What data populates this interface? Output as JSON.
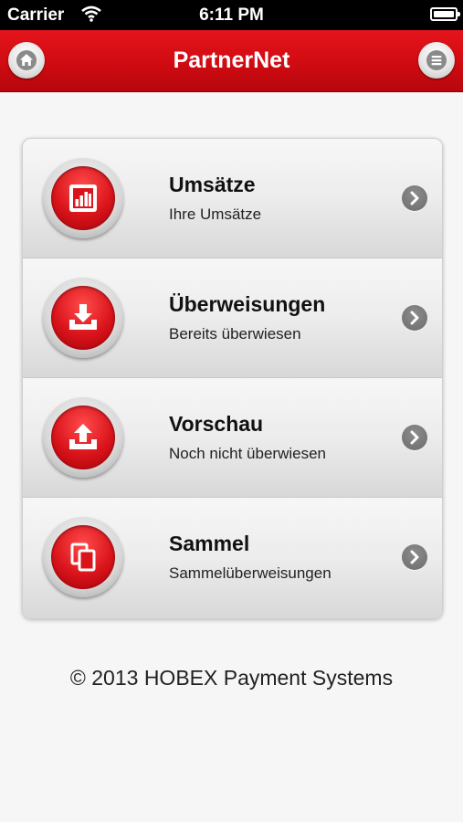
{
  "status_bar": {
    "carrier": "Carrier",
    "time": "6:11 PM"
  },
  "nav": {
    "title": "PartnerNet",
    "left_icon": "home-icon",
    "right_icon": "menu-icon"
  },
  "menu": {
    "items": [
      {
        "title": "Umsätze",
        "subtitle": "Ihre Umsätze",
        "icon": "bar-chart-icon"
      },
      {
        "title": "Überweisungen",
        "subtitle": "Bereits überwiesen",
        "icon": "download-tray-icon"
      },
      {
        "title": "Vorschau",
        "subtitle": "Noch nicht überwiesen",
        "icon": "upload-tray-icon"
      },
      {
        "title": "Sammel",
        "subtitle": "Sammelüberweisungen",
        "icon": "documents-icon"
      }
    ]
  },
  "footer": {
    "text": "© 2013 HOBEX Payment Systems"
  },
  "colors": {
    "brand_red": "#d00b12",
    "background": "#f6f6f6"
  }
}
